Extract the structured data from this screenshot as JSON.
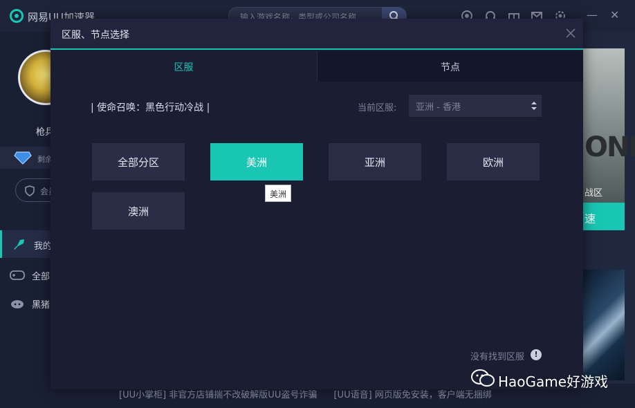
{
  "app": {
    "name": "网易UU加速器",
    "search_placeholder": "输入游戏名称，类型或公司名称",
    "user_name": "枪兵",
    "gem_text": "剩余",
    "member_text": "会员",
    "nav": [
      {
        "label": "我的"
      },
      {
        "label": "全部"
      },
      {
        "label": "黑猪"
      }
    ],
    "promo": {
      "word": "ONE",
      "sub": "战区",
      "button": "速"
    },
    "ticker": [
      "[UU小掌柜] 非官方店铺揣不改破解版UU盗号诈骗",
      "[UU语音] 网页版免安装，客户端无捆绑"
    ]
  },
  "modal": {
    "title": "区服、节点选择",
    "tabs": [
      {
        "label": "区服",
        "active": true
      },
      {
        "label": "节点",
        "active": false
      }
    ],
    "game_label": "| 使命召唤：黑色行动冷战 |",
    "current_label": "当前区服:",
    "current_value": "亚洲 - 香港",
    "regions": [
      {
        "label": "全部分区",
        "selected": false
      },
      {
        "label": "美洲",
        "selected": true
      },
      {
        "label": "亚洲",
        "selected": false
      },
      {
        "label": "欧洲",
        "selected": false
      },
      {
        "label": "澳洲",
        "selected": false
      }
    ],
    "tooltip": "美洲",
    "not_found": "没有找到区服",
    "not_found_icon": "!"
  },
  "watermark": {
    "text": "HaoGame好游戏"
  },
  "colors": {
    "accent": "#19c6b4",
    "modal_bg": "#1b1d33",
    "button_bg": "#2a2d45"
  }
}
